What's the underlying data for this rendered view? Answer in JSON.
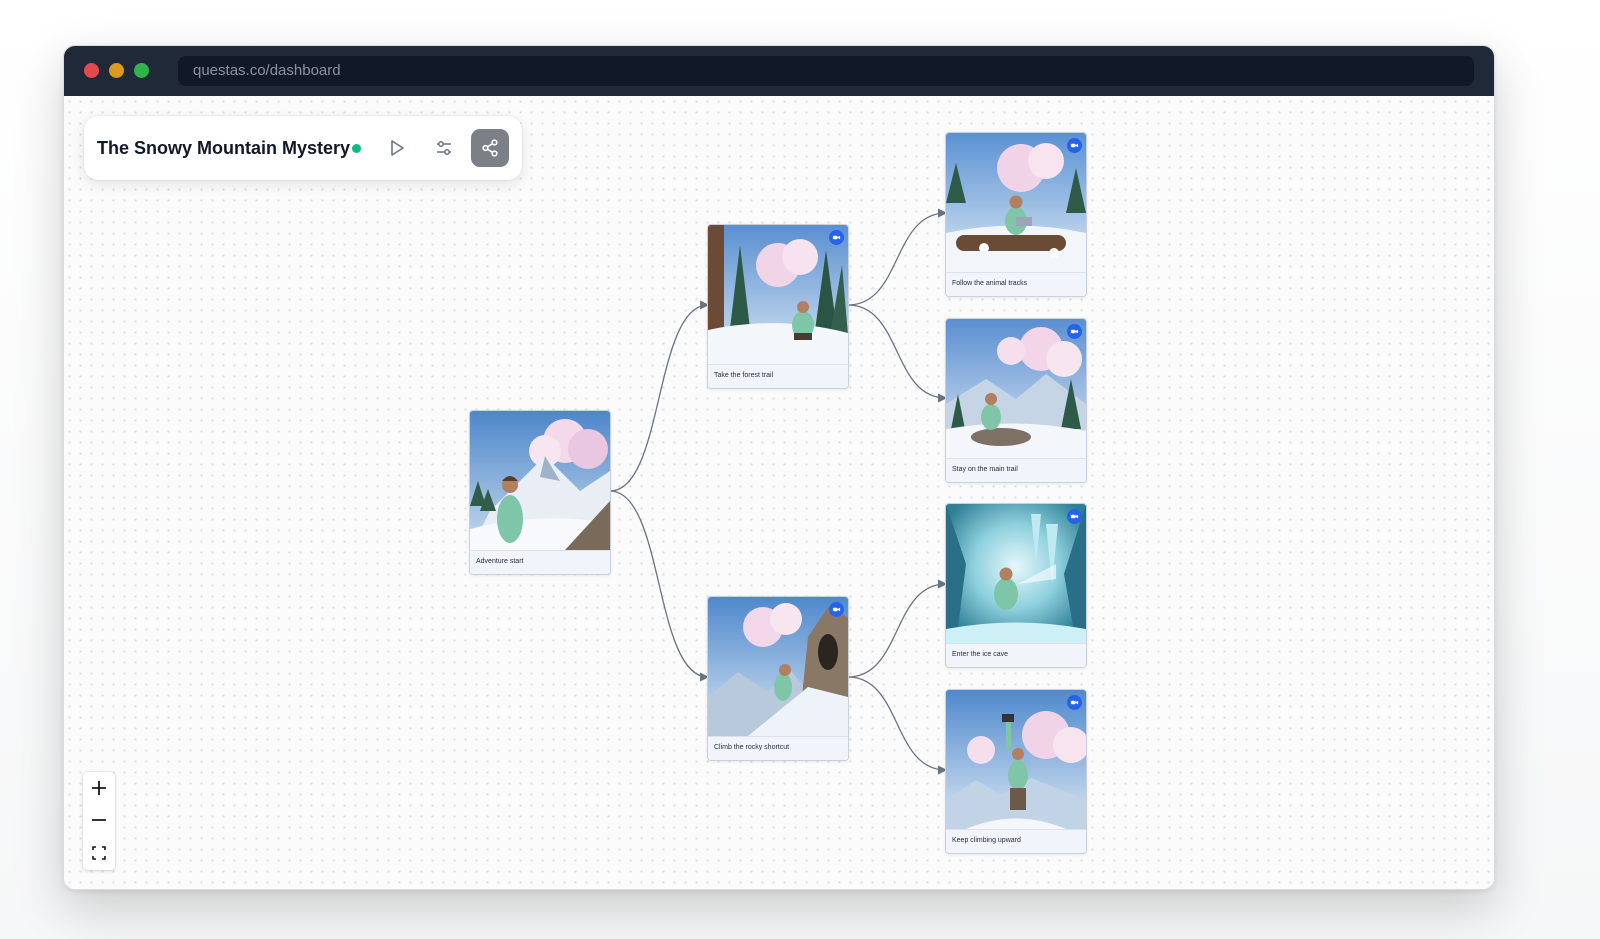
{
  "browser": {
    "url": "questas.co/dashboard"
  },
  "toolbar": {
    "title": "The Snowy Mountain Mystery",
    "status_color": "#10b981",
    "icons": [
      "play-icon",
      "settings-sliders-icon",
      "share-icon"
    ]
  },
  "nodes": [
    {
      "id": "start",
      "caption": "Adventure start",
      "has_video": false,
      "scene": "mountain-portrait"
    },
    {
      "id": "forest",
      "caption": "Take the forest trail",
      "has_video": true,
      "scene": "forest-crouch"
    },
    {
      "id": "rocky",
      "caption": "Climb the rocky shortcut",
      "has_video": true,
      "scene": "rock-climb"
    },
    {
      "id": "tracks",
      "caption": "Follow the animal tracks",
      "has_video": true,
      "scene": "log-seat"
    },
    {
      "id": "main",
      "caption": "Stay on the main trail",
      "has_video": true,
      "scene": "rock-sit"
    },
    {
      "id": "cave",
      "caption": "Enter the ice cave",
      "has_video": true,
      "scene": "ice-cave"
    },
    {
      "id": "upward",
      "caption": "Keep climbing upward",
      "has_video": true,
      "scene": "summit"
    }
  ],
  "edges": [
    [
      "start",
      "forest"
    ],
    [
      "start",
      "rocky"
    ],
    [
      "forest",
      "tracks"
    ],
    [
      "forest",
      "main"
    ],
    [
      "rocky",
      "cave"
    ],
    [
      "rocky",
      "upward"
    ]
  ],
  "zoom_controls": [
    "zoom-in",
    "zoom-out",
    "fit-view"
  ],
  "colors": {
    "titlebar": "#1f2937",
    "share_button": "#7b7f86",
    "video_badge": "#2563eb",
    "edge": "#6b7280"
  }
}
